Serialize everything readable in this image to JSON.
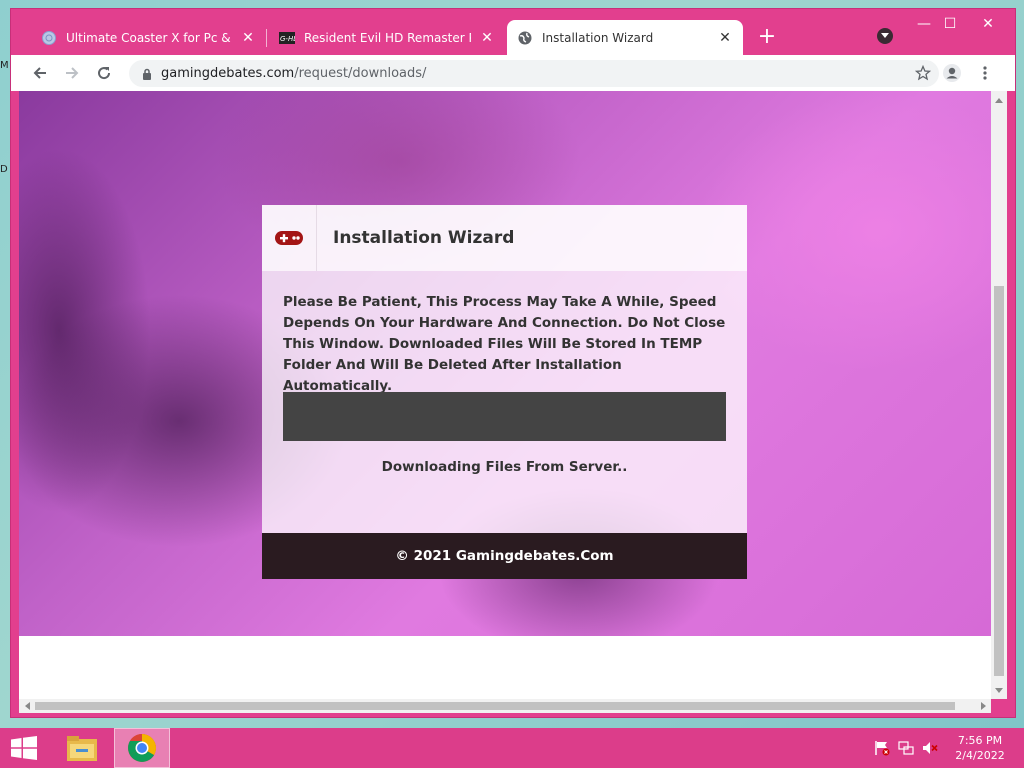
{
  "desktop": {
    "fragment_1": "M",
    "fragment_2": "D"
  },
  "browser": {
    "tabs": [
      {
        "title": "Ultimate Coaster X for Pc & Linux",
        "close_label": "✕",
        "active": false
      },
      {
        "title": "Resident Evil HD Remaster PC Ga",
        "close_label": "✕",
        "active": false
      },
      {
        "title": "Installation Wizard",
        "close_label": "✕",
        "active": true
      }
    ],
    "new_tab_label": "+",
    "window_controls": {
      "minimize": "—",
      "maximize": "☐",
      "close": "✕"
    },
    "address": {
      "domain": "gamingdebates.com",
      "path": "/request/downloads/"
    }
  },
  "wizard": {
    "title": "Installation Wizard",
    "message": "Please Be Patient, This Process May Take A While, Speed Depends On Your Hardware And Connection. Do Not Close This Window. Downloaded Files Will Be Stored In TEMP Folder And Will Be Deleted After Installation Automatically.",
    "progress_fraction": 0,
    "status": "Downloading Files From Server..",
    "footer": "© 2021 Gamingdebates.Com"
  },
  "taskbar": {
    "clock_time": "7:56 PM",
    "clock_date": "2/4/2022"
  },
  "colors": {
    "accent": "#e23f8e",
    "progress_track": "#444444",
    "footer_bg": "#2a1b20"
  },
  "icons": [
    "tab-globe-icon",
    "gamepad-icon",
    "lock-icon",
    "star-icon",
    "profile-icon",
    "menu-dots-icon",
    "back-arrow-icon",
    "forward-arrow-icon",
    "reload-icon",
    "windows-start-icon",
    "file-explorer-icon",
    "chrome-icon",
    "flag-icon",
    "network-icon",
    "volume-muted-icon"
  ]
}
